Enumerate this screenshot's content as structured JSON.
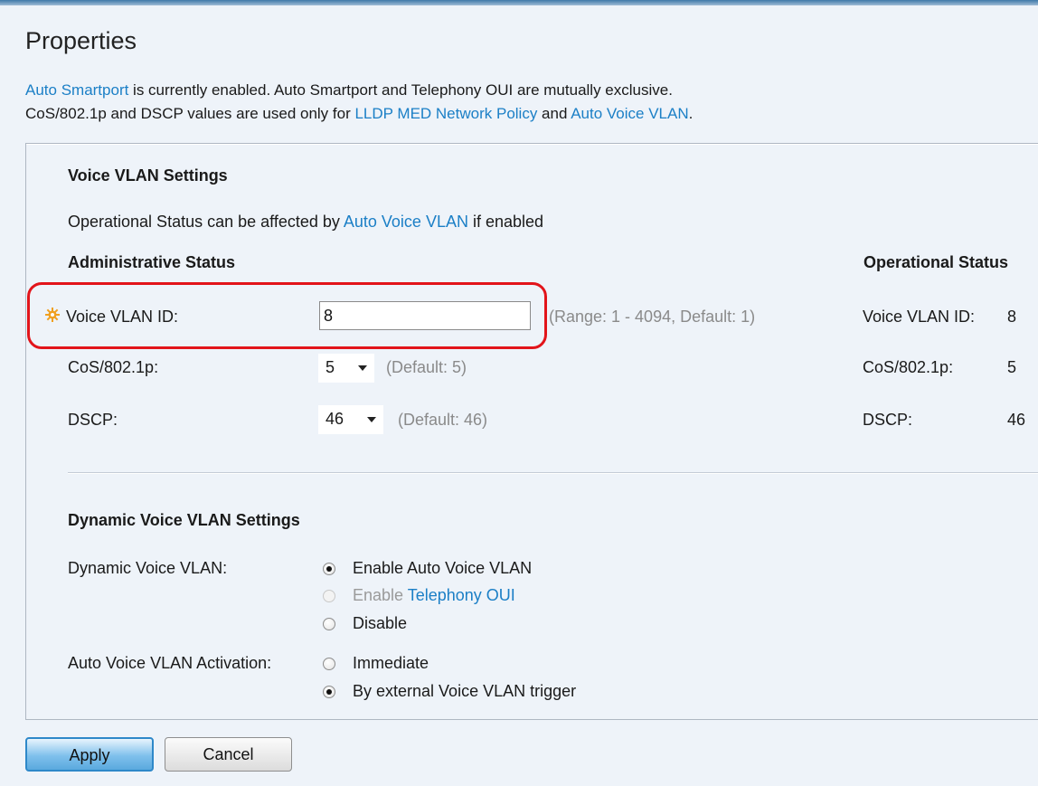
{
  "page": {
    "title": "Properties"
  },
  "info": {
    "line1": {
      "link": "Auto Smartport",
      "text": " is currently enabled. Auto Smartport and Telephony OUI are mutually exclusive."
    },
    "line2": {
      "pre": "CoS/802.1p and DSCP values are used only for ",
      "link1": "LLDP MED Network Policy",
      "mid": " and ",
      "link2": "Auto Voice VLAN",
      "post": "."
    }
  },
  "voice_vlan": {
    "heading": "Voice VLAN Settings",
    "note": {
      "pre": "Operational Status can be affected by ",
      "link": "Auto Voice VLAN",
      "post": " if enabled"
    },
    "admin_heading": "Administrative Status",
    "oper_heading": "Operational Status",
    "vlan_id": {
      "label": "Voice VLAN ID:",
      "value": "8",
      "hint": "(Range: 1 - 4094, Default: 1)"
    },
    "cos": {
      "label": "CoS/802.1p:",
      "selected": "5",
      "hint": "(Default: 5)"
    },
    "dscp": {
      "label": "DSCP:",
      "selected": "46",
      "hint": "(Default: 46)"
    },
    "operational": {
      "vlan_id_label": "Voice VLAN ID:",
      "vlan_id_value": "8",
      "cos_label": "CoS/802.1p:",
      "cos_value": "5",
      "dscp_label": "DSCP:",
      "dscp_value": "46"
    }
  },
  "dynamic": {
    "heading": "Dynamic Voice VLAN Settings",
    "label": "Dynamic Voice VLAN:",
    "options": {
      "auto": "Enable Auto Voice VLAN",
      "oui_pre": "Enable ",
      "oui_link": "Telephony OUI",
      "disable": "Disable"
    },
    "selected": "auto",
    "activation": {
      "label": "Auto Voice VLAN Activation:",
      "immediate": "Immediate",
      "trigger": "By external Voice VLAN trigger",
      "selected": "trigger"
    }
  },
  "buttons": {
    "apply": "Apply",
    "cancel": "Cancel"
  },
  "colors": {
    "link": "#1b7fc6",
    "highlight": "#e2141a",
    "apply_border": "#2e88c9",
    "background": "#eef3f9"
  },
  "icons": {
    "required": "gear-icon"
  }
}
